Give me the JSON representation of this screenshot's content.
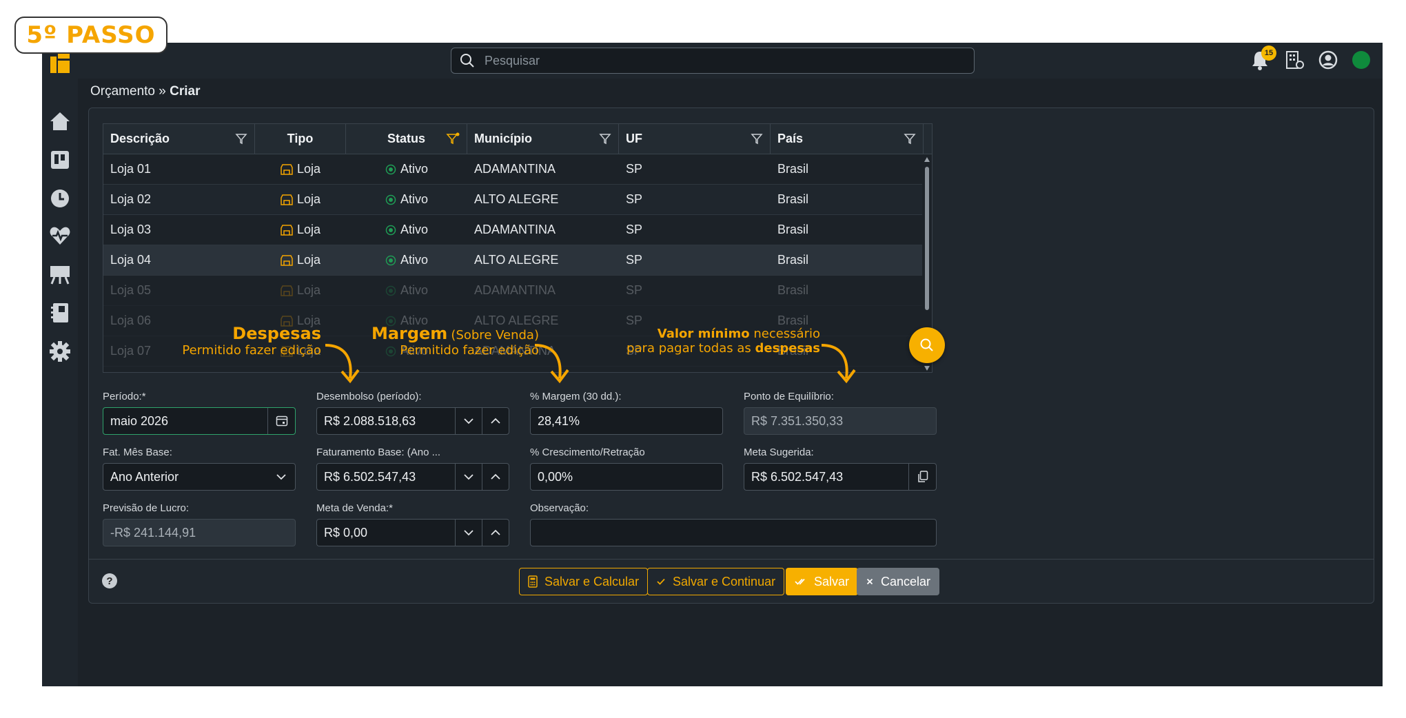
{
  "step_badge": "5º PASSO",
  "search": {
    "placeholder": "Pesquisar"
  },
  "notifications": {
    "count": "15"
  },
  "breadcrumb": {
    "parent": "Orçamento",
    "separator": "»",
    "current": "Criar"
  },
  "table": {
    "headers": [
      "Descrição",
      "Tipo",
      "Status",
      "Município",
      "UF",
      "País"
    ],
    "rows": [
      {
        "descricao": "Loja 01",
        "tipo": "Loja",
        "status": "Ativo",
        "municipio": "ADAMANTINA",
        "uf": "SP",
        "pais": "Brasil"
      },
      {
        "descricao": "Loja 02",
        "tipo": "Loja",
        "status": "Ativo",
        "municipio": "ALTO ALEGRE",
        "uf": "SP",
        "pais": "Brasil"
      },
      {
        "descricao": "Loja 03",
        "tipo": "Loja",
        "status": "Ativo",
        "municipio": "ADAMANTINA",
        "uf": "SP",
        "pais": "Brasil"
      },
      {
        "descricao": "Loja 04",
        "tipo": "Loja",
        "status": "Ativo",
        "municipio": "ALTO ALEGRE",
        "uf": "SP",
        "pais": "Brasil"
      },
      {
        "descricao": "Loja 05",
        "tipo": "Loja",
        "status": "Ativo",
        "municipio": "ADAMANTINA",
        "uf": "SP",
        "pais": "Brasil"
      },
      {
        "descricao": "Loja 06",
        "tipo": "Loja",
        "status": "Ativo",
        "municipio": "ALTO ALEGRE",
        "uf": "SP",
        "pais": "Brasil"
      },
      {
        "descricao": "Loja 07",
        "tipo": "Loja",
        "status": "Ativo",
        "municipio": "ADAMANTINA",
        "uf": "SP",
        "pais": "Brasil"
      }
    ]
  },
  "form": {
    "periodo": {
      "label": "Período:*",
      "value": "maio 2026"
    },
    "desembolso": {
      "label": "Desembolso (período):",
      "value": "R$ 2.088.518,63"
    },
    "margem": {
      "label": "% Margem (30 dd.):",
      "value": "28,41%"
    },
    "ponto_equilibrio": {
      "label": "Ponto de Equilíbrio:",
      "value": "R$ 7.351.350,33"
    },
    "fat_mes_base": {
      "label": "Fat. Mês Base:",
      "value": "Ano Anterior"
    },
    "faturamento_base": {
      "label": "Faturamento Base: (Ano ...",
      "value": "R$ 6.502.547,43"
    },
    "crescimento": {
      "label": "% Crescimento/Retração",
      "value": "0,00%"
    },
    "meta_sugerida": {
      "label": "Meta Sugerida:",
      "value": "R$ 6.502.547,43"
    },
    "previsao_lucro": {
      "label": "Previsão de Lucro:",
      "value": "-R$ 241.144,91"
    },
    "meta_venda": {
      "label": "Meta de Venda:*",
      "value": "R$ 0,00"
    },
    "observacao": {
      "label": "Observação:",
      "value": ""
    }
  },
  "buttons": {
    "salvar_calcular": "Salvar e Calcular",
    "salvar_continuar": "Salvar e Continuar",
    "salvar": "Salvar",
    "cancelar": "Cancelar",
    "help": "?"
  },
  "annotations": {
    "despesas": {
      "title": "Despesas",
      "sub": "Permitido fazer edição"
    },
    "margem": {
      "title": "Margem",
      "title_suffix": "(Sobre Venda)",
      "sub": "Permitido fazer edição"
    },
    "valor_minimo": {
      "bold1": "Valor mínimo",
      "text1": "necessário",
      "text2": "para pagar todas as",
      "bold2": "despesas"
    }
  },
  "colors": {
    "accent": "#f7b000",
    "annotation": "#f5a500",
    "status_active": "#1f9d55",
    "background": "#1c2228"
  }
}
